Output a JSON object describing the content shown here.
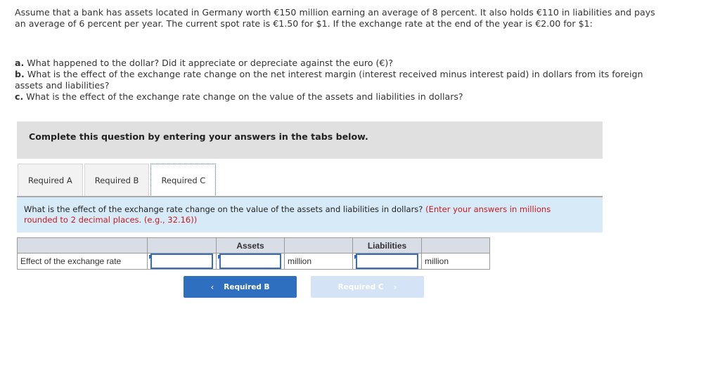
{
  "problem": {
    "text": "Assume that a bank has assets located in Germany worth €150 million earning an average of 8 percent. It also holds €110 in liabilities and pays an average of 6 percent per year. The current spot rate is €1.50 for $1. If the exchange rate at the end of the year is €2.00 for $1:"
  },
  "parts": [
    {
      "label": "a.",
      "text": " What happened to the dollar? Did it appreciate or depreciate against the euro (€)?"
    },
    {
      "label": "b.",
      "text": " What is the effect of the exchange rate change on the net interest margin (interest received minus interest paid) in dollars from its foreign assets and liabilities?"
    },
    {
      "label": "c.",
      "text": " What is the effect of the exchange rate change on the value of the assets and liabilities in dollars?"
    }
  ],
  "instruction": "Complete this question by entering your answers in the tabs below.",
  "tabs": [
    {
      "label": "Required A",
      "active": false
    },
    {
      "label": "Required B",
      "active": false
    },
    {
      "label": "Required C",
      "active": true
    }
  ],
  "question": {
    "text": "What is the effect of the exchange rate change on the value of the assets and liabilities in dollars? ",
    "hint": "(Enter your answers in millions rounded to 2 decimal places. (e.g., 32.16))"
  },
  "table": {
    "headers": [
      "",
      "",
      "Assets",
      "",
      "Liabilities",
      ""
    ],
    "row": {
      "label": "Effect of the exchange rate",
      "select_value": "",
      "assets_value": "",
      "assets_unit": "million",
      "liabilities_value": "",
      "liabilities_unit": "million"
    }
  },
  "nav": {
    "prev_label": "Required B",
    "next_label": "Required C",
    "prev_icon": "‹",
    "next_icon": "›"
  },
  "colors": {
    "hint_red": "#c8191e",
    "button_blue": "#2f6fc0",
    "button_disabled": "#d4e3f5",
    "panel_blue": "#d7eaf8"
  }
}
